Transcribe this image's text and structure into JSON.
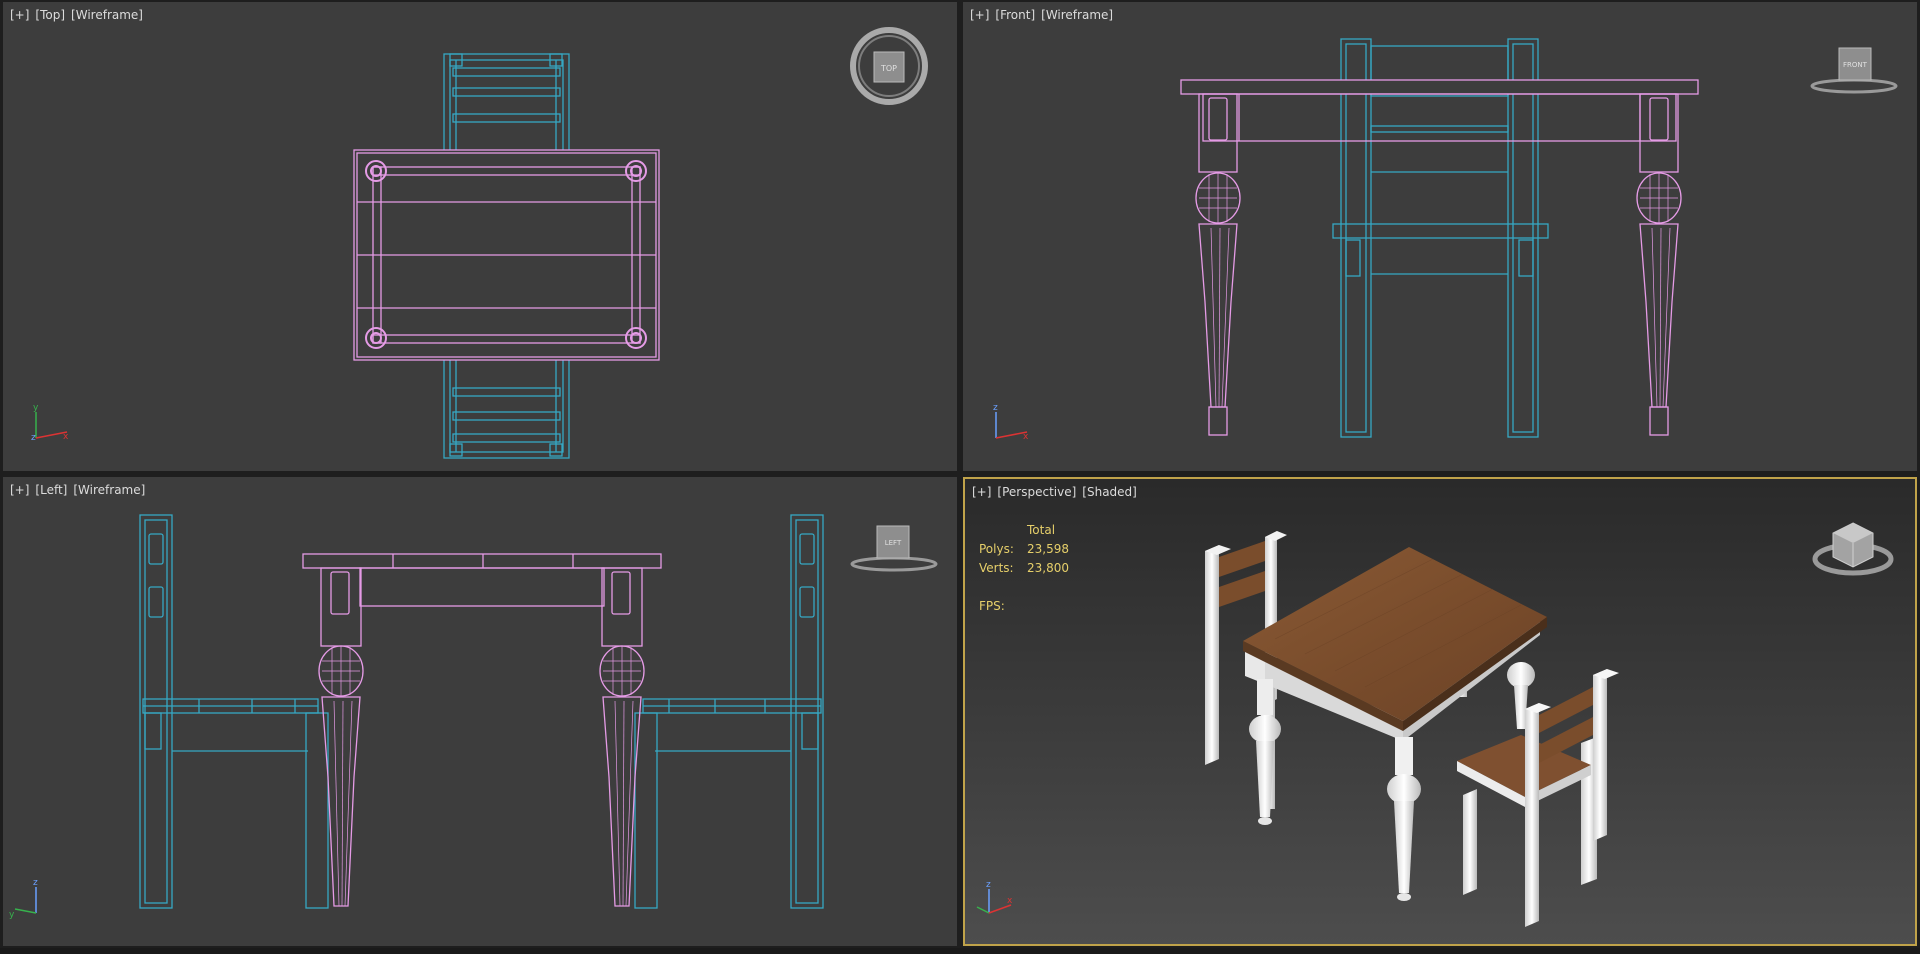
{
  "viewports": {
    "top": {
      "label_plus": "[+]",
      "label_view": "[Top]",
      "label_mode": "[Wireframe]",
      "cube_text": "TOP"
    },
    "front": {
      "label_plus": "[+]",
      "label_view": "[Front]",
      "label_mode": "[Wireframe]",
      "cube_text": "FRONT"
    },
    "left": {
      "label_plus": "[+]",
      "label_view": "[Left]",
      "label_mode": "[Wireframe]",
      "cube_text": "LEFT"
    },
    "perspective": {
      "label_plus": "[+]",
      "label_view": "[Perspective]",
      "label_mode": "[Shaded]",
      "stats": {
        "header": "Total",
        "polys_label": "Polys:",
        "polys_value": "23,598",
        "verts_label": "Verts:",
        "verts_value": "23,800",
        "fps_label": "FPS:"
      }
    }
  },
  "axes": {
    "x": "x",
    "y": "y",
    "z": "z"
  },
  "colors": {
    "table": "#e59be6",
    "chair": "#36a8c4",
    "active_border": "#c0a34a",
    "stats": "#e6cf6a"
  },
  "icons": [
    "viewcube-icon",
    "axis-tripod-icon"
  ]
}
